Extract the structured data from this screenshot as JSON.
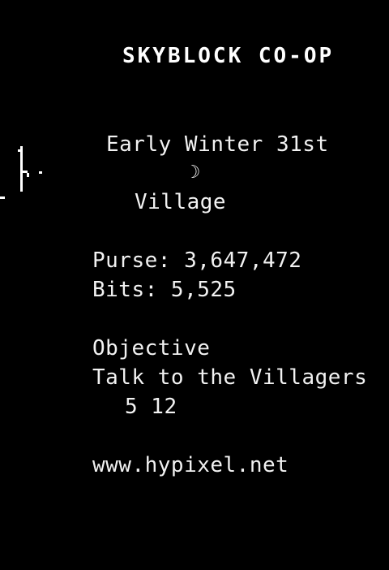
{
  "scoreboard": {
    "title": "SKYBLOCK CO-OP",
    "date": "Early Winter 31st",
    "moon_icon": "☽",
    "location": "Village",
    "purse": "Purse: 3,647,472",
    "bits": "Bits: 5,525",
    "objective_label": "Objective",
    "objective_text": "Talk to the Villagers",
    "objective_progress": "5 12",
    "website": "www.hypixel.net"
  }
}
